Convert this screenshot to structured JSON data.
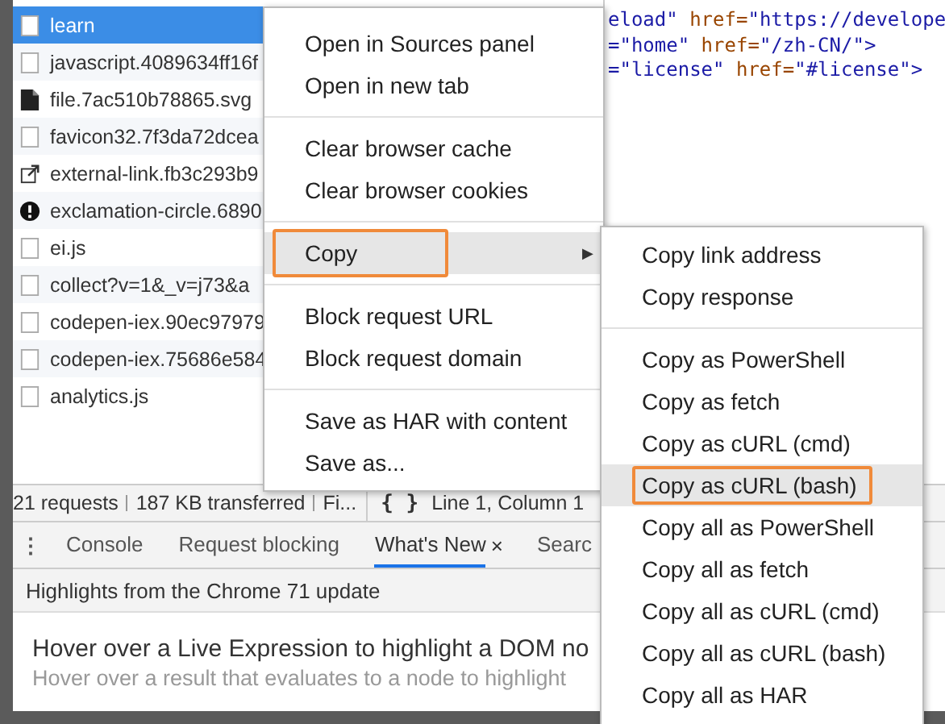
{
  "requests": [
    {
      "name": "learn",
      "kind": "doc",
      "selected": true
    },
    {
      "name": "javascript.4089634ff16f",
      "kind": "doc",
      "selected": false
    },
    {
      "name": "file.7ac510b78865.svg",
      "kind": "file",
      "selected": false
    },
    {
      "name": "favicon32.7f3da72dcea",
      "kind": "doc",
      "selected": false
    },
    {
      "name": "external-link.fb3c293b9",
      "kind": "link",
      "selected": false
    },
    {
      "name": "exclamation-circle.6890",
      "kind": "alert",
      "selected": false
    },
    {
      "name": "ei.js",
      "kind": "doc",
      "selected": false
    },
    {
      "name": "collect?v=1&_v=j73&a",
      "kind": "doc",
      "selected": false
    },
    {
      "name": "codepen-iex.90ec97979",
      "kind": "doc",
      "selected": false
    },
    {
      "name": "codepen-iex.75686e584",
      "kind": "doc",
      "selected": false
    },
    {
      "name": "analytics.js",
      "kind": "doc",
      "selected": false
    }
  ],
  "code_lines": [
    [
      {
        "text": "eload\"",
        "kind": "value"
      },
      {
        "text": " href=",
        "kind": "attr"
      },
      {
        "text": "\"https://develope",
        "kind": "value"
      }
    ],
    [
      {
        "text": "=\"home\"",
        "kind": "value"
      },
      {
        "text": " href=",
        "kind": "attr"
      },
      {
        "text": "\"/zh-CN/\">",
        "kind": "value"
      }
    ],
    [
      {
        "text": "=\"license\"",
        "kind": "value"
      },
      {
        "text": " href=",
        "kind": "attr"
      },
      {
        "text": "\"#license\">",
        "kind": "value"
      }
    ]
  ],
  "status_bar": {
    "items": [
      "21 requests",
      "187 KB transferred",
      "Fi..."
    ],
    "format_button": "{ }",
    "position": "Line 1, Column 1"
  },
  "drawer": {
    "menu": "⋮",
    "tabs": [
      {
        "label": "Console",
        "selected": false
      },
      {
        "label": "Request blocking",
        "selected": false
      },
      {
        "label": "What's New",
        "selected": true,
        "close": "×"
      },
      {
        "label": "Searc",
        "selected": false
      }
    ],
    "banner": "Highlights from the Chrome 71 update",
    "heading": "Hover over a Live Expression to highlight a DOM no",
    "description": "Hover over a result that evaluates to a node to highlight"
  },
  "context_menu": {
    "groups": [
      [
        {
          "label": "Open in Sources panel",
          "selected": false
        },
        {
          "label": "Open in new tab",
          "selected": false
        }
      ],
      [
        {
          "label": "Clear browser cache",
          "selected": false
        },
        {
          "label": "Clear browser cookies",
          "selected": false
        }
      ],
      [
        {
          "label": "Copy",
          "selected": true,
          "outlined": true,
          "arrow": "▶"
        }
      ],
      [
        {
          "label": "Block request URL",
          "selected": false
        },
        {
          "label": "Block request domain",
          "selected": false
        }
      ],
      [
        {
          "label": "Save as HAR with content",
          "selected": false
        },
        {
          "label": "Save as...",
          "selected": false
        }
      ]
    ]
  },
  "submenu": {
    "groups": [
      [
        {
          "label": "Copy link address",
          "selected": false
        },
        {
          "label": "Copy response",
          "selected": false
        }
      ],
      [
        {
          "label": "Copy as PowerShell",
          "selected": false
        },
        {
          "label": "Copy as fetch",
          "selected": false
        },
        {
          "label": "Copy as cURL (cmd)",
          "selected": false
        },
        {
          "label": "Copy as cURL (bash)",
          "selected": true,
          "outlined": true
        },
        {
          "label": "Copy all as PowerShell",
          "selected": false
        },
        {
          "label": "Copy all as fetch",
          "selected": false
        },
        {
          "label": "Copy all as cURL (cmd)",
          "selected": false
        },
        {
          "label": "Copy all as cURL (bash)",
          "selected": false
        },
        {
          "label": "Copy all as HAR",
          "selected": false
        }
      ]
    ]
  }
}
